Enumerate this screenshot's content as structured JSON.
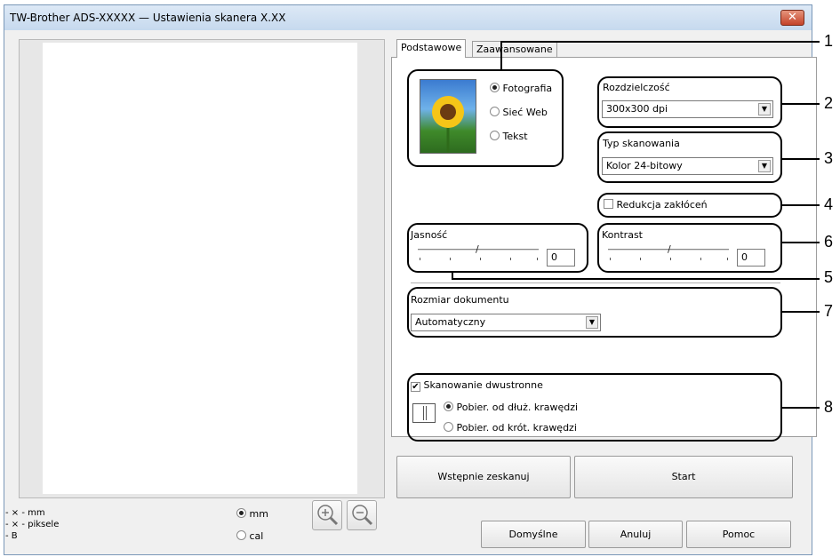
{
  "window": {
    "title": "TW-Brother ADS-XXXXX — Ustawienia skanera X.XX",
    "close_glyph": "✕"
  },
  "preview_info": {
    "line1": "- × - mm",
    "line2": "- × - piksele",
    "line3": "- B"
  },
  "units": {
    "mm": "mm",
    "cal": "cal",
    "selected": "mm"
  },
  "zoom": {
    "in_glyph": "⊕",
    "out_glyph": "⊖"
  },
  "tabs": [
    {
      "label": "Podstawowe",
      "active": true
    },
    {
      "label": "Zaawansowane",
      "active": false
    }
  ],
  "scan_mode": {
    "options": [
      "Fotografia",
      "Sieć Web",
      "Tekst"
    ],
    "selected": "Fotografia"
  },
  "resolution": {
    "label": "Rozdzielczość",
    "value": "300x300 dpi"
  },
  "scan_type": {
    "label": "Typ skanowania",
    "value": "Kolor 24-bitowy"
  },
  "noise_reduction": {
    "label": "Redukcja zakłóceń",
    "checked": false
  },
  "brightness": {
    "label": "Jasność",
    "value": "0"
  },
  "contrast": {
    "label": "Kontrast",
    "value": "0"
  },
  "document_size": {
    "label": "Rozmiar dokumentu",
    "value": "Automatyczny"
  },
  "duplex": {
    "label": "Skanowanie dwustronne",
    "checked": true,
    "options": [
      "Pobier. od dłuż. krawędzi",
      "Pobier. od krót. krawędzi"
    ],
    "selected": "Pobier. od dłuż. krawędzi"
  },
  "buttons": {
    "prescan": "Wstępnie zeskanuj",
    "start": "Start",
    "defaults": "Domyślne",
    "cancel": "Anuluj",
    "help": "Pomoc"
  },
  "callouts": [
    "1",
    "2",
    "3",
    "4",
    "5",
    "6",
    "7",
    "8"
  ],
  "colors": {
    "accent_close": "#c4432a",
    "titlebar": "#c6d9ee"
  },
  "icons": {
    "photo": "sunflower-photo-icon"
  }
}
